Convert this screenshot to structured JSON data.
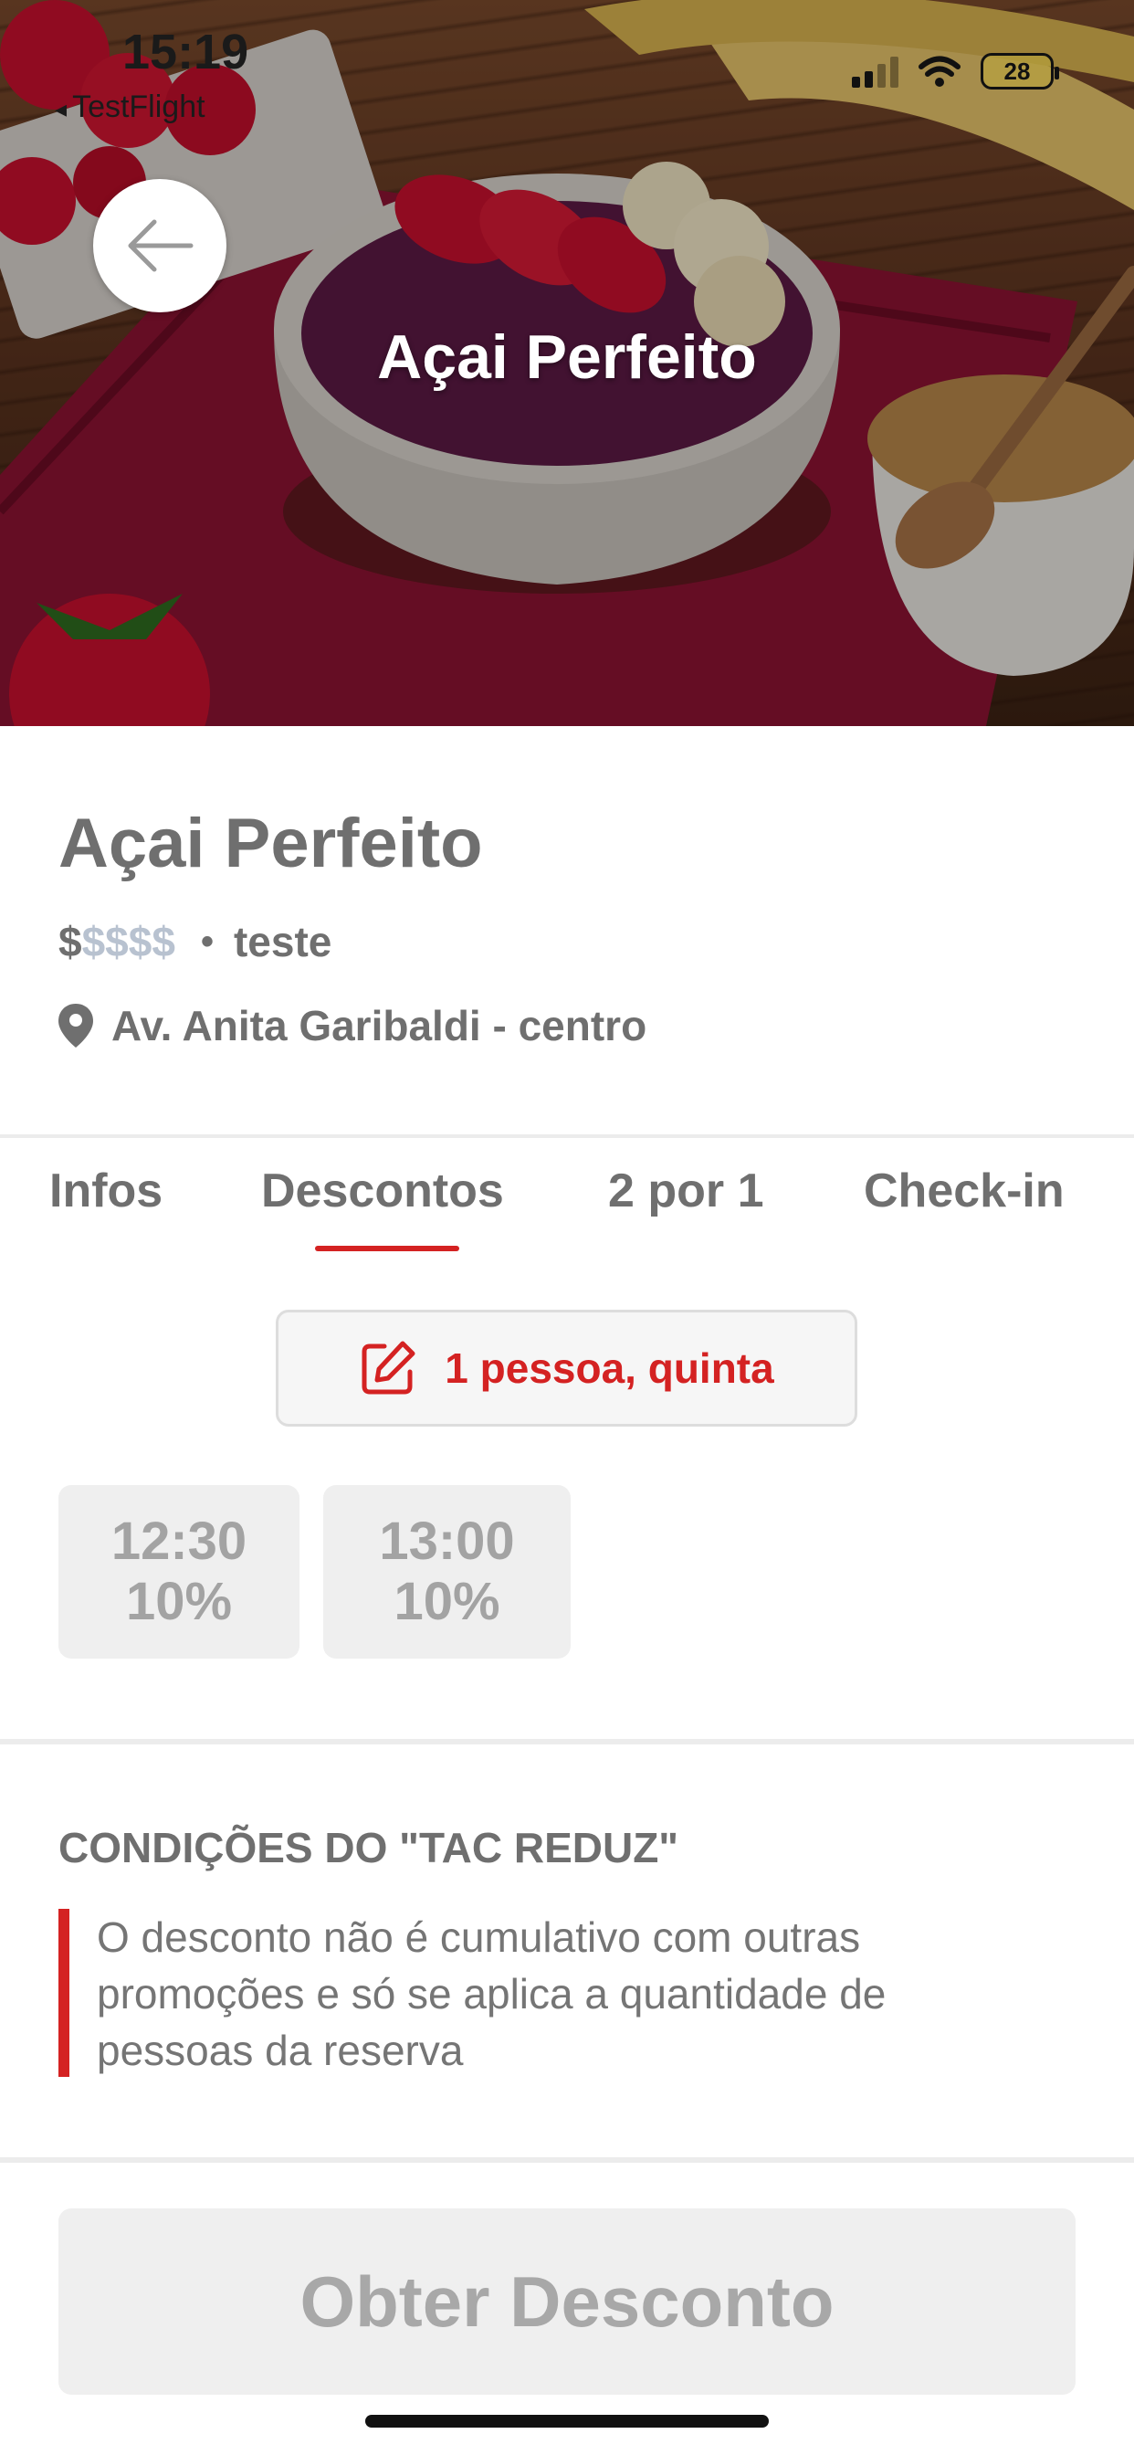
{
  "status_bar": {
    "time": "15:19",
    "back_app": "TestFlight",
    "battery": "28"
  },
  "header": {
    "title": "Açai Perfeito",
    "back_icon": "arrow-left-icon"
  },
  "restaurant": {
    "name": "Açai Perfeito",
    "price_active": "$",
    "price_inactive": "$$$$",
    "separator": "•",
    "category": "teste",
    "address": "Av. Anita Garibaldi - centro",
    "location_icon": "map-pin-icon"
  },
  "tabs": [
    {
      "label": "Infos",
      "active": false
    },
    {
      "label": "Descontos",
      "active": true
    },
    {
      "label": "2 por 1",
      "active": false
    },
    {
      "label": "Check-in",
      "active": false
    }
  ],
  "filter": {
    "label": "1 pessoa, quinta",
    "icon": "edit-icon"
  },
  "time_slots": [
    {
      "time": "12:30",
      "discount": "10%"
    },
    {
      "time": "13:00",
      "discount": "10%"
    }
  ],
  "conditions": {
    "title": "CONDIÇÕES DO \"TAC REDUZ\"",
    "text": "O desconto não é cumulativo com outras promoções e só se aplica a quantidade de pessoas da reserva"
  },
  "cta": {
    "label": "Obter Desconto"
  },
  "colors": {
    "accent": "#d42222",
    "text_gray": "#6f6f6f",
    "disabled_bg": "#efefef"
  }
}
